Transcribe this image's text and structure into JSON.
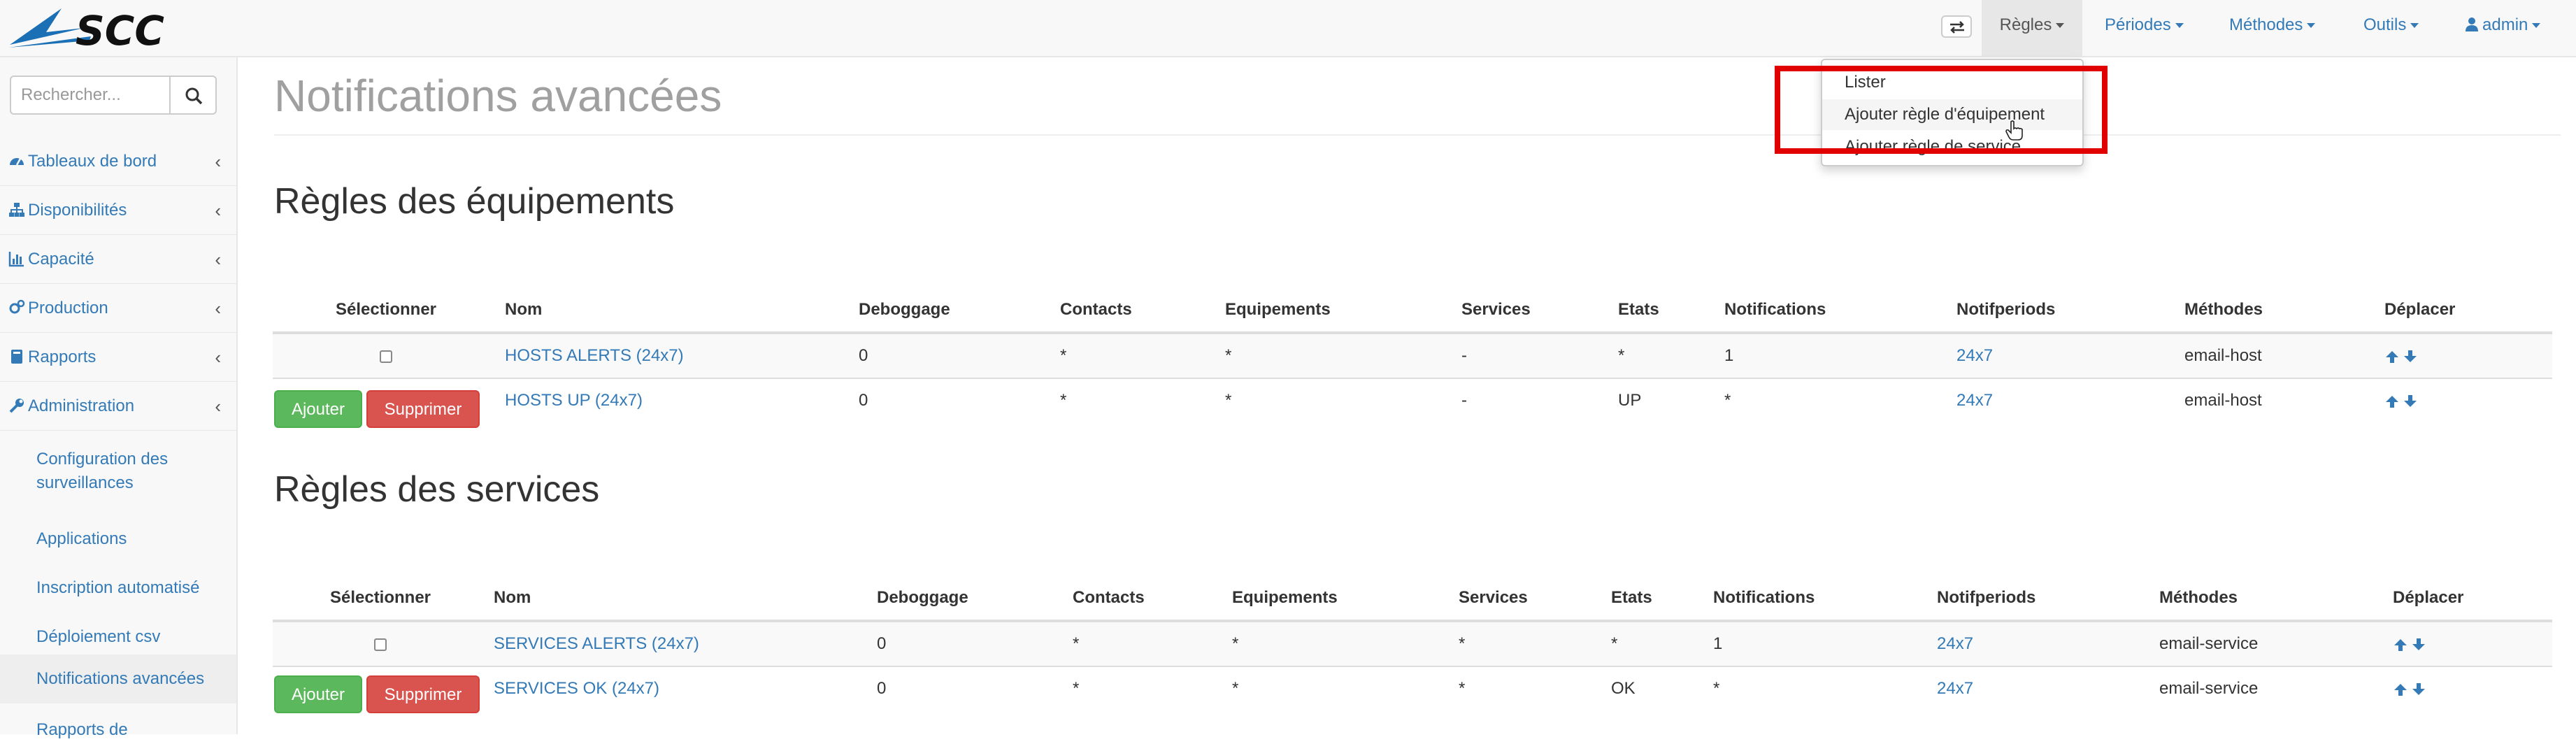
{
  "brand": {
    "logo_text": "SCC"
  },
  "navbar": {
    "toggle_icon": "swap-icon",
    "items": [
      {
        "label": "Règles"
      },
      {
        "label": "Périodes"
      },
      {
        "label": "Méthodes"
      },
      {
        "label": "Outils"
      },
      {
        "label": "admin",
        "icon": "user-icon"
      }
    ]
  },
  "dropdown": {
    "items": [
      "Lister",
      "Ajouter règle d'équipement",
      "Ajouter règle de service"
    ]
  },
  "sidebar": {
    "search_placeholder": "Rechercher...",
    "items": [
      {
        "label": "Tableaux de bord",
        "icon": "dashboard-icon"
      },
      {
        "label": "Disponibilités",
        "icon": "sitemap-icon"
      },
      {
        "label": "Capacité",
        "icon": "bar-chart-icon"
      },
      {
        "label": "Production",
        "icon": "gears-icon"
      },
      {
        "label": "Rapports",
        "icon": "book-icon"
      },
      {
        "label": "Administration",
        "icon": "wrench-icon"
      }
    ],
    "subitems": [
      {
        "line1": "Configuration des",
        "line2": "surveillances"
      },
      {
        "line1": "Applications"
      },
      {
        "line1": "Inscription automatisé"
      },
      {
        "line1": "Déploiement csv"
      },
      {
        "line1": "Notifications avancées"
      },
      {
        "line1": "Rapports de"
      }
    ]
  },
  "page": {
    "title": "Notifications avancées"
  },
  "columns": [
    "Sélectionner",
    "Nom",
    "Deboggage",
    "Contacts",
    "Equipements",
    "Services",
    "Etats",
    "Notifications",
    "Notifperiods",
    "Méthodes",
    "Déplacer"
  ],
  "host_rules": {
    "title": "Règles des équipements",
    "rows": [
      {
        "nom": "HOSTS ALERTS (24x7)",
        "debug": "0",
        "contacts": "*",
        "equipements": "*",
        "services": "-",
        "etats": "*",
        "notifications": "1",
        "notifperiods": "24x7",
        "methodes": "email-host"
      },
      {
        "nom": "HOSTS UP (24x7)",
        "debug": "0",
        "contacts": "*",
        "equipements": "*",
        "services": "-",
        "etats": "UP",
        "notifications": "*",
        "notifperiods": "24x7",
        "methodes": "email-host"
      }
    ]
  },
  "service_rules": {
    "title": "Règles des services",
    "rows": [
      {
        "nom": "SERVICES ALERTS (24x7)",
        "debug": "0",
        "contacts": "*",
        "equipements": "*",
        "services": "*",
        "etats": "*",
        "notifications": "1",
        "notifperiods": "24x7",
        "methodes": "email-service"
      },
      {
        "nom": "SERVICES OK (24x7)",
        "debug": "0",
        "contacts": "*",
        "equipements": "*",
        "services": "*",
        "etats": "OK",
        "notifications": "*",
        "notifperiods": "24x7",
        "methodes": "email-service"
      }
    ]
  },
  "buttons": {
    "add": "Ajouter",
    "delete": "Supprimer"
  },
  "colors": {
    "link": "#337ab7",
    "success": "#5cb85c",
    "danger": "#d9534f",
    "highlight": "#e00000",
    "logo": "#1a6fb5"
  }
}
